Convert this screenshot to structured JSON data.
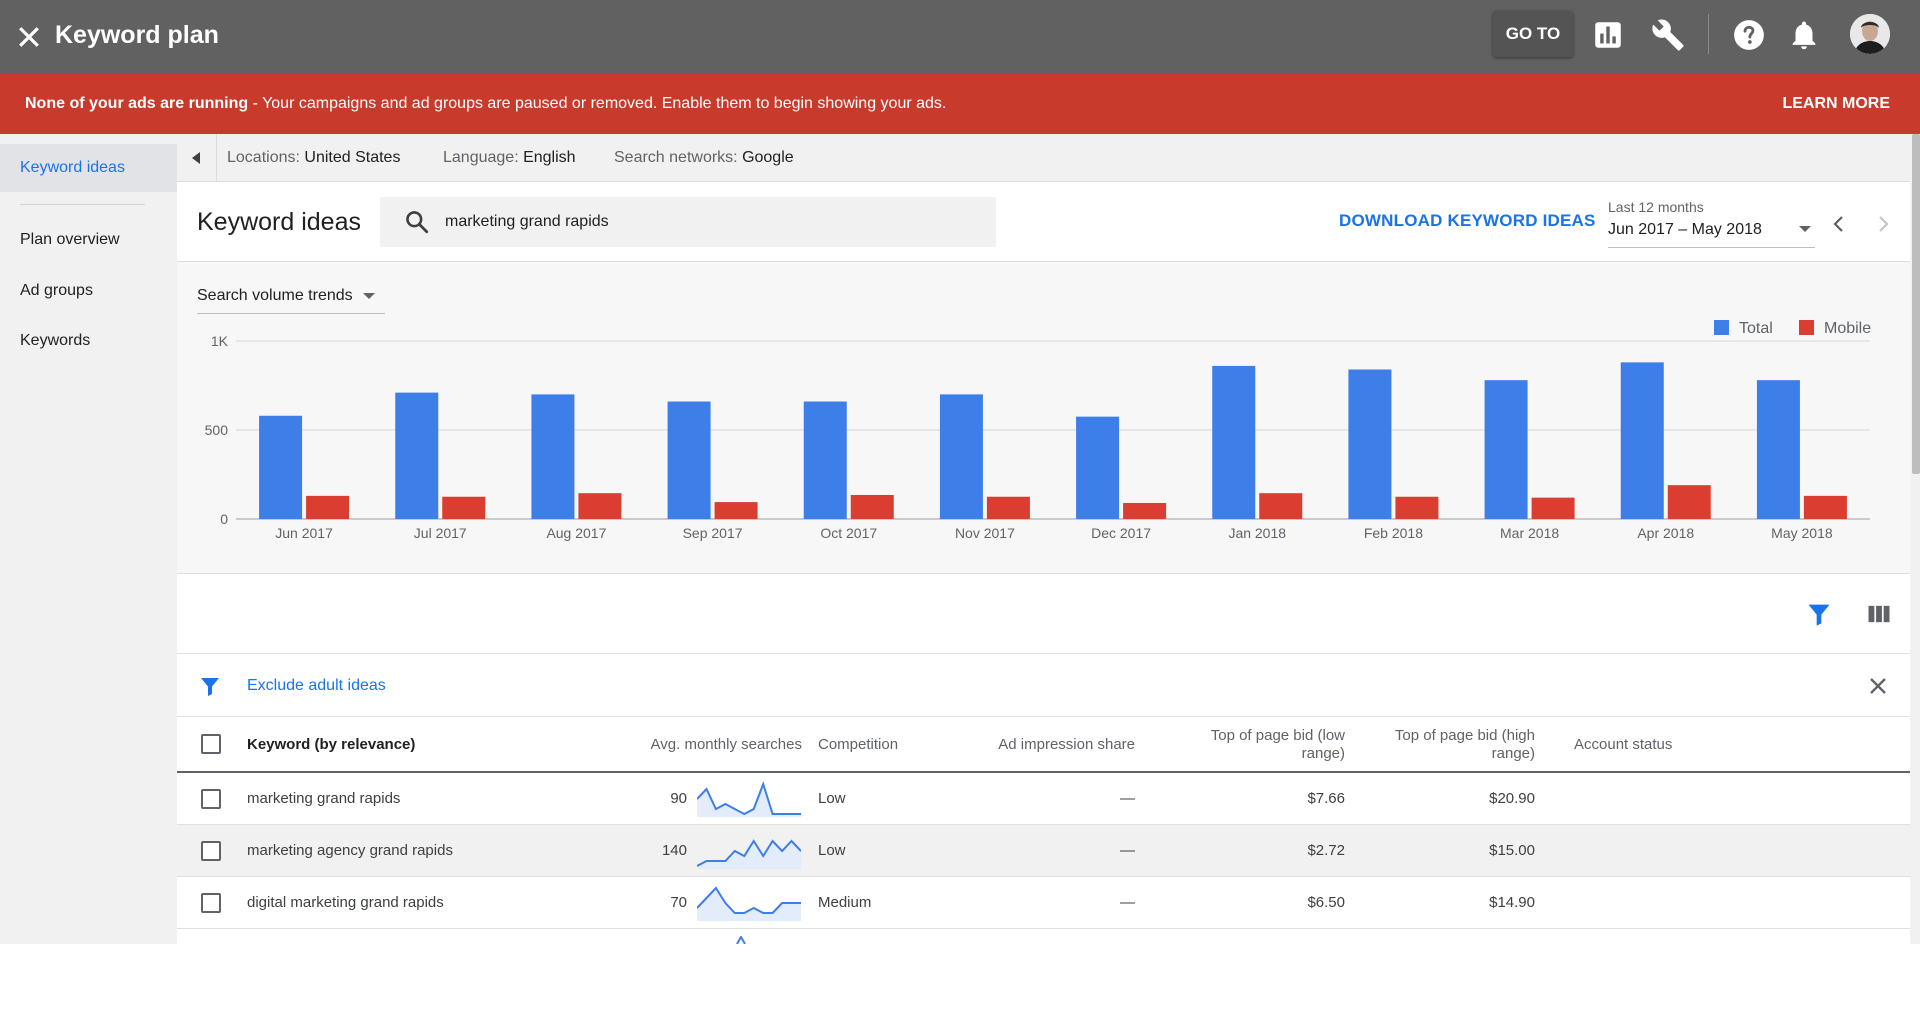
{
  "app": {
    "title": "Keyword plan",
    "goto_label": "GO TO"
  },
  "topbar_icons": [
    "close-icon",
    "reports-icon",
    "tools-icon",
    "help-icon",
    "notifications-icon",
    "avatar"
  ],
  "alert": {
    "bold": "None of your ads are running",
    "text": " - Your campaigns and ad groups are paused or removed. Enable them to begin showing your ads.",
    "action": "LEARN MORE",
    "color": "#c73a2c"
  },
  "sidebar": {
    "items": [
      {
        "label": "Keyword ideas",
        "active": true
      },
      {
        "label": "Plan overview"
      },
      {
        "label": "Ad groups"
      },
      {
        "label": "Keywords"
      }
    ]
  },
  "filters": {
    "location_label": "Locations: ",
    "location_value": "United States",
    "language_label": "Language: ",
    "language_value": "English",
    "network_label": "Search networks: ",
    "network_value": "Google"
  },
  "header": {
    "title": "Keyword ideas",
    "search_value": "marketing grand rapids",
    "download_label": "DOWNLOAD KEYWORD IDEAS",
    "date_label": "Last 12 months",
    "date_value": "Jun 2017 – May 2018"
  },
  "trend_selector": "Search volume trends",
  "chart_data": {
    "type": "bar",
    "categories": [
      "Jun 2017",
      "Jul 2017",
      "Aug 2017",
      "Sep 2017",
      "Oct 2017",
      "Nov 2017",
      "Dec 2017",
      "Jan 2018",
      "Feb 2018",
      "Mar 2018",
      "Apr 2018",
      "May 2018"
    ],
    "series": [
      {
        "name": "Total",
        "color": "#3d7ee8",
        "values": [
          580,
          710,
          700,
          660,
          660,
          700,
          575,
          860,
          840,
          780,
          880,
          780
        ]
      },
      {
        "name": "Mobile",
        "color": "#dc3d31",
        "values": [
          130,
          125,
          145,
          95,
          135,
          125,
          90,
          145,
          125,
          120,
          190,
          130
        ]
      }
    ],
    "yticks": [
      "0",
      "500",
      "1K"
    ],
    "ylim": [
      0,
      1000
    ],
    "grid": true,
    "legend": "top-right"
  },
  "filter_chip": "Exclude adult ideas",
  "table": {
    "headers": {
      "keyword": "Keyword (by relevance)",
      "avg": "Avg. monthly searches",
      "competition": "Competition",
      "impression": "Ad impression share",
      "bid_low_1": "Top of page bid (low",
      "bid_low_2": "range)",
      "bid_high_1": "Top of page bid (high",
      "bid_high_2": "range)",
      "status": "Account status"
    },
    "rows": [
      {
        "keyword": "marketing grand rapids",
        "avg": "90",
        "competition": "Low",
        "impression": "—",
        "bid_low": "$7.66",
        "bid_high": "$20.90",
        "trend": [
          3,
          1,
          5,
          4,
          5,
          6,
          5,
          0,
          6,
          6,
          6,
          6
        ]
      },
      {
        "keyword": "marketing agency grand rapids",
        "avg": "140",
        "competition": "Low",
        "impression": "—",
        "bid_low": "$2.72",
        "bid_high": "$15.00",
        "trend": [
          6,
          5,
          5,
          5,
          3,
          4,
          1,
          4,
          1,
          3,
          1,
          3
        ]
      },
      {
        "keyword": "digital marketing grand rapids",
        "avg": "70",
        "competition": "Medium",
        "impression": "—",
        "bid_low": "$6.50",
        "bid_high": "$14.90",
        "trend": [
          4,
          2,
          0,
          3,
          5,
          5,
          4,
          5,
          5,
          3,
          3,
          3
        ]
      }
    ]
  }
}
